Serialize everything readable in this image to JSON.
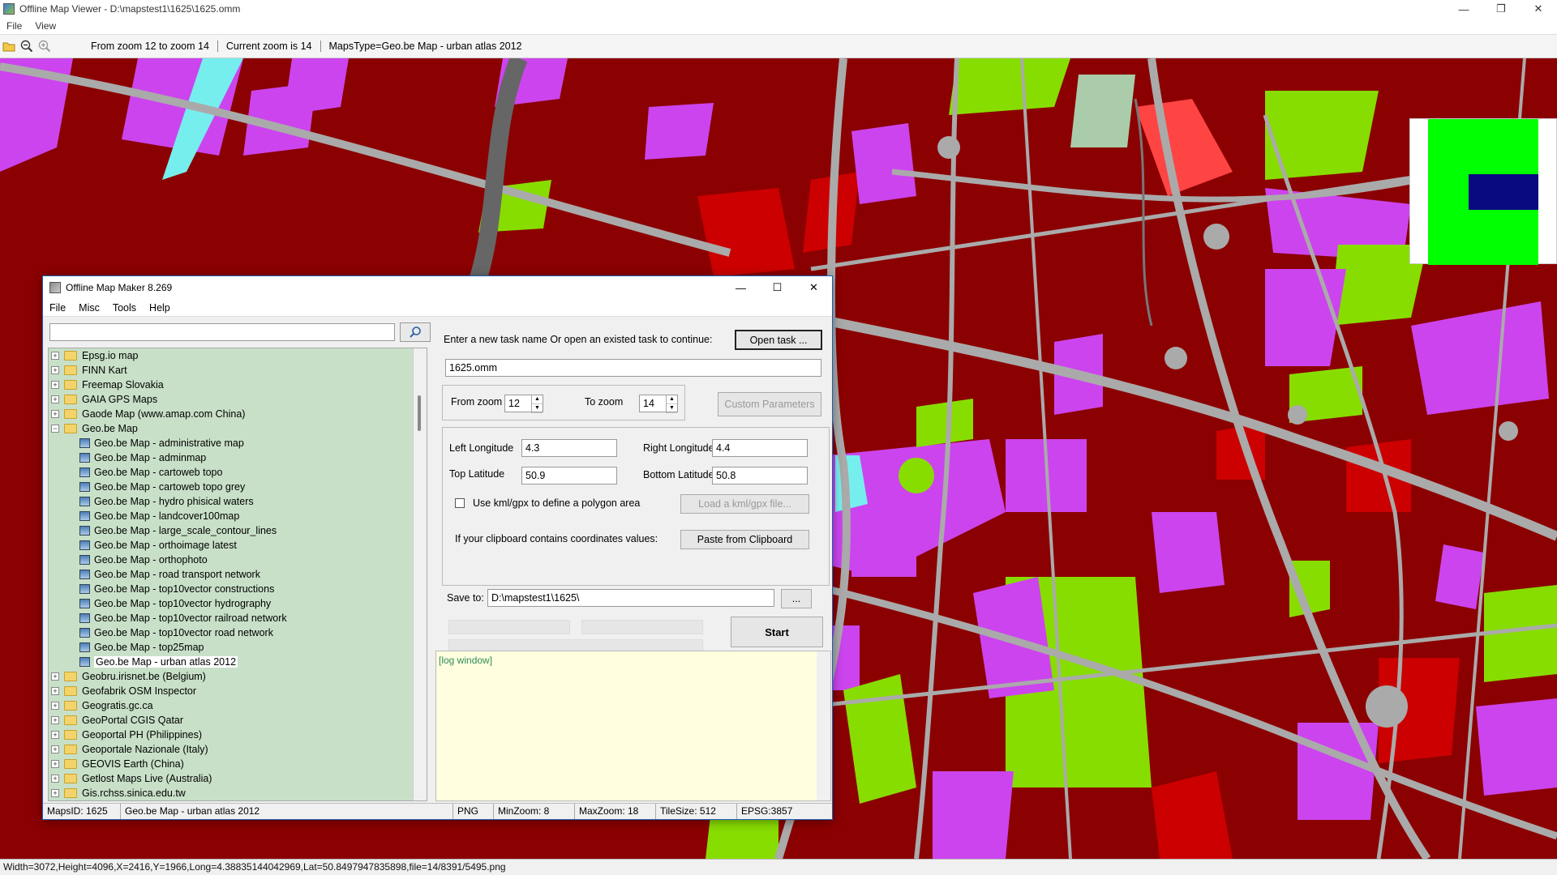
{
  "window": {
    "title": "Offline Map Viewer - D:\\mapstest1\\1625\\1625.omm",
    "menu": [
      "File",
      "View"
    ]
  },
  "toolbar": {
    "info": [
      "From zoom 12 to zoom 14",
      "Current zoom is 14",
      "MapsType=Geo.be Map - urban atlas 2012"
    ]
  },
  "status": {
    "text": "Width=3072,Height=4096,X=2416,Y=1966,Long=4.38835144042969,Lat=50.8497947835898,file=14/8391/5495.png"
  },
  "colors": {
    "map_dark_red": "#8b0000",
    "map_red": "#cc0000",
    "map_magenta": "#cc44ee",
    "map_green": "#88dd00",
    "map_road": "#aaaaaa",
    "map_cyan": "#77eeee",
    "tree_bg": "#c8e0c8",
    "log_bg": "#ffffe0"
  },
  "dialog": {
    "title": "Offline Map Maker 8.269",
    "menu": [
      "File",
      "Misc",
      "Tools",
      "Help"
    ],
    "search": {
      "value": "",
      "placeholder": ""
    },
    "tree": [
      {
        "label": "Epsg.io map",
        "type": "folder",
        "expanded": false
      },
      {
        "label": "FINN Kart",
        "type": "folder",
        "expanded": false
      },
      {
        "label": "Freemap Slovakia",
        "type": "folder",
        "expanded": false
      },
      {
        "label": "GAIA GPS Maps",
        "type": "folder",
        "expanded": false
      },
      {
        "label": "Gaode Map (www.amap.com China)",
        "type": "folder",
        "expanded": false
      },
      {
        "label": "Geo.be Map",
        "type": "folder",
        "expanded": true
      },
      {
        "label": "Geo.be Map - administrative map",
        "type": "map"
      },
      {
        "label": "Geo.be Map - adminmap",
        "type": "map"
      },
      {
        "label": "Geo.be Map - cartoweb topo",
        "type": "map"
      },
      {
        "label": "Geo.be Map - cartoweb topo grey",
        "type": "map"
      },
      {
        "label": "Geo.be Map - hydro phisical waters",
        "type": "map"
      },
      {
        "label": "Geo.be Map - landcover100map",
        "type": "map"
      },
      {
        "label": "Geo.be Map - large_scale_contour_lines",
        "type": "map"
      },
      {
        "label": "Geo.be Map - orthoimage latest",
        "type": "map"
      },
      {
        "label": "Geo.be Map - orthophoto",
        "type": "map"
      },
      {
        "label": "Geo.be Map - road transport network",
        "type": "map"
      },
      {
        "label": "Geo.be Map - top10vector constructions",
        "type": "map"
      },
      {
        "label": "Geo.be Map - top10vector hydrography",
        "type": "map"
      },
      {
        "label": "Geo.be Map - top10vector railroad network",
        "type": "map"
      },
      {
        "label": "Geo.be Map - top10vector road network",
        "type": "map"
      },
      {
        "label": "Geo.be Map - top25map",
        "type": "map"
      },
      {
        "label": "Geo.be Map - urban atlas 2012",
        "type": "map",
        "selected": true
      },
      {
        "label": "Geobru.irisnet.be (Belgium)",
        "type": "folder",
        "expanded": false
      },
      {
        "label": "Geofabrik OSM Inspector",
        "type": "folder",
        "expanded": false
      },
      {
        "label": "Geogratis.gc.ca",
        "type": "folder",
        "expanded": false
      },
      {
        "label": "GeoPortal CGIS Qatar",
        "type": "folder",
        "expanded": false
      },
      {
        "label": "Geoportal PH (Philippines)",
        "type": "folder",
        "expanded": false
      },
      {
        "label": "Geoportale Nazionale (Italy)",
        "type": "folder",
        "expanded": false
      },
      {
        "label": "GEOVIS Earth (China)",
        "type": "folder",
        "expanded": false
      },
      {
        "label": "Getlost Maps Live (Australia)",
        "type": "folder",
        "expanded": false
      },
      {
        "label": "Gis.rchss.sinica.edu.tw",
        "type": "folder",
        "expanded": false
      }
    ],
    "task_prompt": "Enter a new task name Or open an existed task to continue:",
    "open_task_label": "Open task ...",
    "task_name": "1625.omm",
    "from_zoom_label": "From zoom",
    "from_zoom": "12",
    "to_zoom_label": "To zoom",
    "to_zoom": "14",
    "custom_params_label": "Custom Parameters",
    "left_lon_label": "Left Longitude",
    "left_lon": "4.3",
    "right_lon_label": "Right Longitude",
    "right_lon": "4.4",
    "top_lat_label": "Top Latitude",
    "top_lat": "50.9",
    "bottom_lat_label": "Bottom Latitude",
    "bottom_lat": "50.8",
    "kml_label": "Use kml/gpx to define a polygon area",
    "load_kml_label": "Load a kml/gpx file...",
    "clipboard_prompt": "If your clipboard contains coordinates values:",
    "paste_label": "Paste from Clipboard",
    "save_to_label": "Save to:",
    "save_to": "D:\\mapstest1\\1625\\",
    "browse_label": "...",
    "start_label": "Start",
    "log_text": "[log window]",
    "status": [
      "MapsID: 1625",
      "Geo.be Map - urban atlas 2012",
      "PNG",
      "MinZoom: 8",
      "MaxZoom: 18",
      "TileSize: 512",
      "EPSG:3857"
    ]
  }
}
